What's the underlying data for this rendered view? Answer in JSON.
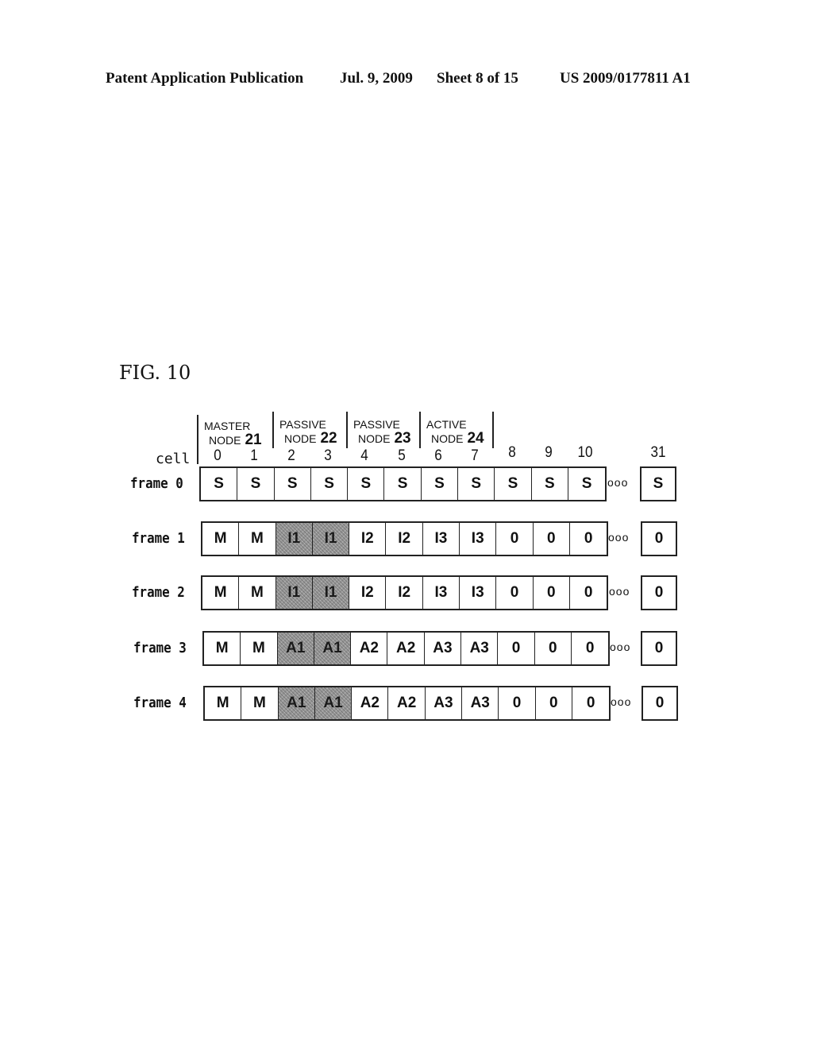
{
  "header": {
    "publication": "Patent Application Publication",
    "date": "Jul. 9, 2009",
    "sheet": "Sheet 8 of 15",
    "number": "US 2009/0177811 A1"
  },
  "figure": {
    "title": "FIG. 10",
    "cell_label": "cell",
    "nodes": [
      {
        "role": "MASTER",
        "word": "NODE",
        "number": "21",
        "cells": [
          0,
          1
        ]
      },
      {
        "role": "PASSIVE",
        "word": "NODE",
        "number": "22",
        "cells": [
          2,
          3
        ]
      },
      {
        "role": "PASSIVE",
        "word": "NODE",
        "number": "23",
        "cells": [
          4,
          5
        ]
      },
      {
        "role": "ACTIVE",
        "word": "NODE",
        "number": "24",
        "cells": [
          6,
          7
        ]
      }
    ],
    "cell_indices": [
      "0",
      "1",
      "2",
      "3",
      "4",
      "5",
      "6",
      "7",
      "8",
      "9",
      "10"
    ],
    "last_cell_index": "31",
    "ellipsis": "ooo",
    "shaded_color": "#9a9a9a",
    "frames": [
      {
        "label": "frame 0",
        "cells": [
          "S",
          "S",
          "S",
          "S",
          "S",
          "S",
          "S",
          "S",
          "S",
          "S",
          "S"
        ],
        "last": "S",
        "shaded": []
      },
      {
        "label": "frame 1",
        "cells": [
          "M",
          "M",
          "I1",
          "I1",
          "I2",
          "I2",
          "I3",
          "I3",
          "0",
          "0",
          "0"
        ],
        "last": "0",
        "shaded": [
          2,
          3
        ]
      },
      {
        "label": "frame 2",
        "cells": [
          "M",
          "M",
          "I1",
          "I1",
          "I2",
          "I2",
          "I3",
          "I3",
          "0",
          "0",
          "0"
        ],
        "last": "0",
        "shaded": [
          2,
          3
        ]
      },
      {
        "label": "frame 3",
        "cells": [
          "M",
          "M",
          "A1",
          "A1",
          "A2",
          "A2",
          "A3",
          "A3",
          "0",
          "0",
          "0"
        ],
        "last": "0",
        "shaded": [
          2,
          3
        ]
      },
      {
        "label": "frame 4",
        "cells": [
          "M",
          "M",
          "A1",
          "A1",
          "A2",
          "A2",
          "A3",
          "A3",
          "0",
          "0",
          "0"
        ],
        "last": "0",
        "shaded": [
          2,
          3
        ]
      }
    ]
  }
}
